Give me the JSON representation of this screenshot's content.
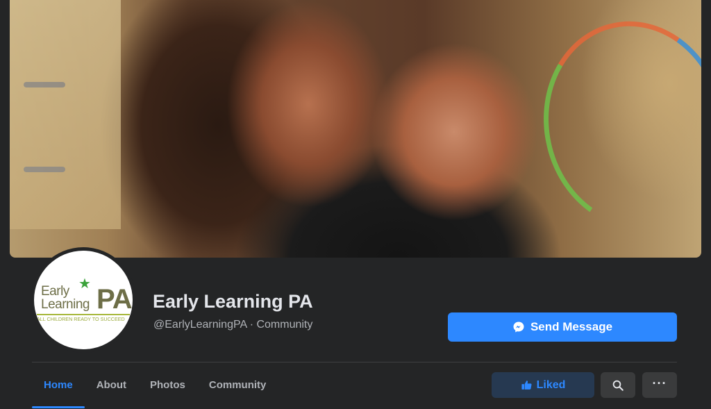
{
  "page": {
    "name": "Early Learning PA",
    "handle": "@EarlyLearningPA · Community"
  },
  "cover": {
    "icon": "cover-photo"
  },
  "logo": {
    "word1": "Early",
    "word2": "Learning",
    "pa": "PA",
    "tagline": "ALL CHILDREN READY TO SUCCEED"
  },
  "actions": {
    "send_message": "Send Message",
    "liked": "Liked"
  },
  "tabs": [
    {
      "label": "Home",
      "active": true
    },
    {
      "label": "About",
      "active": false
    },
    {
      "label": "Photos",
      "active": false
    },
    {
      "label": "Community",
      "active": false
    }
  ],
  "colors": {
    "accent": "#2d88ff",
    "background": "#242526",
    "liked_bg": "#263951"
  }
}
